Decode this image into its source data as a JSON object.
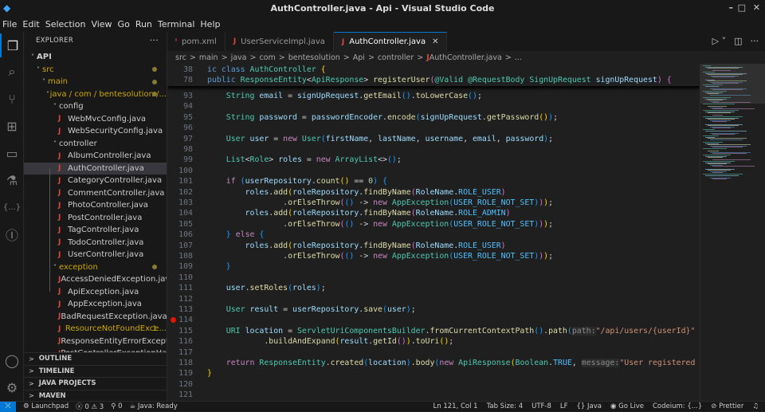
{
  "window": {
    "title": "AuthController.java - Api - Visual Studio Code",
    "controls": [
      "–",
      "□",
      "✕"
    ]
  },
  "menu": [
    "File",
    "Edit",
    "Selection",
    "View",
    "Go",
    "Run",
    "Terminal",
    "Help"
  ],
  "sidebar": {
    "title": "EXPLORER",
    "more": "···",
    "tree": [
      {
        "label": "API",
        "depth": 0,
        "folder": true,
        "bold": true
      },
      {
        "label": "src",
        "depth": 1,
        "folder": true,
        "modified": true,
        "dot": true
      },
      {
        "label": "main",
        "depth": 2,
        "folder": true,
        "modified": true,
        "dot": true
      },
      {
        "label": "java / com / bentesolution /...",
        "depth": 3,
        "folder": true,
        "modified": true,
        "dot": true
      },
      {
        "label": "config",
        "depth": 4,
        "folder": true
      },
      {
        "label": "WebMvcConfig.java",
        "depth": 5
      },
      {
        "label": "WebSecurityConfig.java",
        "depth": 5
      },
      {
        "label": "controller",
        "depth": 4,
        "folder": true
      },
      {
        "label": "AlbumController.java",
        "depth": 5
      },
      {
        "label": "AuthController.java",
        "depth": 5,
        "selected": true
      },
      {
        "label": "CategoryController.java",
        "depth": 5
      },
      {
        "label": "CommentController.java",
        "depth": 5
      },
      {
        "label": "PhotoController.java",
        "depth": 5
      },
      {
        "label": "PostController.java",
        "depth": 5
      },
      {
        "label": "TagController.java",
        "depth": 5
      },
      {
        "label": "TodoController.java",
        "depth": 5
      },
      {
        "label": "UserController.java",
        "depth": 5
      },
      {
        "label": "exception",
        "depth": 4,
        "folder": true,
        "modified": true,
        "dot": true
      },
      {
        "label": "AccessDeniedException.java",
        "depth": 5
      },
      {
        "label": "ApiException.java",
        "depth": 5
      },
      {
        "label": "AppException.java",
        "depth": 5
      },
      {
        "label": "BadRequestException.java",
        "depth": 5
      },
      {
        "label": "ResourceNotFoundExce...",
        "depth": 5,
        "modified": true,
        "count": "1"
      },
      {
        "label": "ResponseEntityErrorExceptio...",
        "depth": 5
      },
      {
        "label": "PostControllerExceptionHan...",
        "depth": 5
      }
    ],
    "panes": [
      "OUTLINE",
      "TIMELINE",
      "JAVA PROJECTS",
      "MAVEN"
    ]
  },
  "tabs": [
    {
      "label": "pom.xml",
      "icon": "xml-icon",
      "active": false
    },
    {
      "label": "UserServiceImpl.java",
      "icon": "java-icon",
      "active": false
    },
    {
      "label": "AuthController.java",
      "icon": "java-icon",
      "active": true
    }
  ],
  "breadcrumb": [
    "src",
    "main",
    "java",
    "com",
    "bentesolution",
    "Api",
    "controller",
    "AuthController.java",
    "..."
  ],
  "editor": {
    "sticky": [
      {
        "num": "38",
        "tokens": [
          [
            "k",
            "ic class "
          ],
          [
            "t",
            "AuthController"
          ],
          [
            "p",
            " "
          ],
          [
            "b1",
            "{"
          ]
        ]
      },
      {
        "num": "78",
        "tokens": [
          [
            "k",
            "public "
          ],
          [
            "t",
            "ResponseEntity"
          ],
          [
            "p",
            "<"
          ],
          [
            "t",
            "ApiResponse"
          ],
          [
            "p",
            "> "
          ],
          [
            "m",
            "registerUser"
          ],
          [
            "b2",
            "("
          ],
          [
            "t",
            "@Valid "
          ],
          [
            "t",
            "@RequestBody "
          ],
          [
            "t",
            "SignUpRequest "
          ],
          [
            "v",
            "signUpRequest"
          ],
          [
            "b2",
            ")"
          ],
          [
            "p",
            " "
          ],
          [
            "b2",
            "{"
          ]
        ]
      }
    ],
    "lines": [
      {
        "num": "93",
        "tokens": [
          [
            "t",
            "    String "
          ],
          [
            "v",
            "email"
          ],
          [
            "p",
            " = "
          ],
          [
            "v",
            "signUpRequest"
          ],
          [
            "p",
            "."
          ],
          [
            "m",
            "getEmail"
          ],
          [
            "b3",
            "()"
          ],
          [
            "p",
            "."
          ],
          [
            "m",
            "toLowerCase"
          ],
          [
            "b3",
            "()"
          ],
          [
            "p",
            ";"
          ]
        ]
      },
      {
        "num": "94",
        "tokens": []
      },
      {
        "num": "95",
        "tokens": [
          [
            "t",
            "    String "
          ],
          [
            "v",
            "password"
          ],
          [
            "p",
            " = "
          ],
          [
            "v",
            "passwordEncoder"
          ],
          [
            "p",
            "."
          ],
          [
            "m",
            "encode"
          ],
          [
            "b3",
            "("
          ],
          [
            "v",
            "signUpRequest"
          ],
          [
            "p",
            "."
          ],
          [
            "m",
            "getPassword"
          ],
          [
            "b1",
            "()"
          ],
          [
            "b3",
            ")"
          ],
          [
            "p",
            ";"
          ]
        ]
      },
      {
        "num": "96",
        "tokens": []
      },
      {
        "num": "97",
        "tokens": [
          [
            "t",
            "    User "
          ],
          [
            "v",
            "user"
          ],
          [
            "p",
            " = "
          ],
          [
            "c",
            "new "
          ],
          [
            "t",
            "User"
          ],
          [
            "b3",
            "("
          ],
          [
            "v",
            "firstName"
          ],
          [
            "p",
            ", "
          ],
          [
            "v",
            "lastName"
          ],
          [
            "p",
            ", "
          ],
          [
            "v",
            "username"
          ],
          [
            "p",
            ", "
          ],
          [
            "v",
            "email"
          ],
          [
            "p",
            ", "
          ],
          [
            "v",
            "password"
          ],
          [
            "b3",
            ")"
          ],
          [
            "p",
            ";"
          ]
        ]
      },
      {
        "num": "98",
        "tokens": []
      },
      {
        "num": "99",
        "tokens": [
          [
            "t",
            "    List"
          ],
          [
            "p",
            "<"
          ],
          [
            "t",
            "Role"
          ],
          [
            "p",
            "> "
          ],
          [
            "v",
            "roles"
          ],
          [
            "p",
            " = "
          ],
          [
            "c",
            "new "
          ],
          [
            "t",
            "ArrayList"
          ],
          [
            "p",
            "<>"
          ],
          [
            "b3",
            "()"
          ],
          [
            "p",
            ";"
          ]
        ]
      },
      {
        "num": "100",
        "tokens": []
      },
      {
        "num": "101",
        "tokens": [
          [
            "c",
            "    if "
          ],
          [
            "b3",
            "("
          ],
          [
            "v",
            "userRepository"
          ],
          [
            "p",
            "."
          ],
          [
            "m",
            "count"
          ],
          [
            "b1",
            "()"
          ],
          [
            "p",
            " == "
          ],
          [
            "n",
            "0"
          ],
          [
            "b3",
            ")"
          ],
          [
            "p",
            " "
          ],
          [
            "b3",
            "{"
          ]
        ]
      },
      {
        "num": "102",
        "tokens": [
          [
            "v",
            "        roles"
          ],
          [
            "p",
            "."
          ],
          [
            "m",
            "add"
          ],
          [
            "b1",
            "("
          ],
          [
            "v",
            "roleRepository"
          ],
          [
            "p",
            "."
          ],
          [
            "m",
            "findByName"
          ],
          [
            "b2",
            "("
          ],
          [
            "v",
            "RoleName"
          ],
          [
            "p",
            "."
          ],
          [
            "o",
            "ROLE_USER"
          ],
          [
            "b2",
            ")"
          ]
        ]
      },
      {
        "num": "103",
        "tokens": [
          [
            "p",
            "                ."
          ],
          [
            "m",
            "orElseThrow"
          ],
          [
            "b2",
            "("
          ],
          [
            "b3",
            "()"
          ],
          [
            "p",
            " -> "
          ],
          [
            "c",
            "new "
          ],
          [
            "t",
            "AppException"
          ],
          [
            "b3",
            "("
          ],
          [
            "o",
            "USER_ROLE_NOT_SET"
          ],
          [
            "b3",
            ")"
          ],
          [
            "b2",
            ")"
          ],
          [
            "b1",
            ")"
          ],
          [
            "p",
            ";"
          ]
        ]
      },
      {
        "num": "104",
        "tokens": [
          [
            "v",
            "        roles"
          ],
          [
            "p",
            "."
          ],
          [
            "m",
            "add"
          ],
          [
            "b1",
            "("
          ],
          [
            "v",
            "roleRepository"
          ],
          [
            "p",
            "."
          ],
          [
            "m",
            "findByName"
          ],
          [
            "b2",
            "("
          ],
          [
            "v",
            "RoleName"
          ],
          [
            "p",
            "."
          ],
          [
            "o",
            "ROLE_ADMIN"
          ],
          [
            "b2",
            ")"
          ]
        ]
      },
      {
        "num": "105",
        "tokens": [
          [
            "p",
            "                ."
          ],
          [
            "m",
            "orElseThrow"
          ],
          [
            "b2",
            "("
          ],
          [
            "b3",
            "()"
          ],
          [
            "p",
            " -> "
          ],
          [
            "c",
            "new "
          ],
          [
            "t",
            "AppException"
          ],
          [
            "b3",
            "("
          ],
          [
            "o",
            "USER_ROLE_NOT_SET"
          ],
          [
            "b3",
            ")"
          ],
          [
            "b2",
            ")"
          ],
          [
            "b1",
            ")"
          ],
          [
            "p",
            ";"
          ]
        ]
      },
      {
        "num": "106",
        "tokens": [
          [
            "b3",
            "    }"
          ],
          [
            "p",
            " "
          ],
          [
            "c",
            "else "
          ],
          [
            "b3",
            "{"
          ]
        ]
      },
      {
        "num": "107",
        "tokens": [
          [
            "v",
            "        roles"
          ],
          [
            "p",
            "."
          ],
          [
            "m",
            "add"
          ],
          [
            "b1",
            "("
          ],
          [
            "v",
            "roleRepository"
          ],
          [
            "p",
            "."
          ],
          [
            "m",
            "findByName"
          ],
          [
            "b2",
            "("
          ],
          [
            "v",
            "RoleName"
          ],
          [
            "p",
            "."
          ],
          [
            "o",
            "ROLE_USER"
          ],
          [
            "b2",
            ")"
          ]
        ]
      },
      {
        "num": "108",
        "tokens": [
          [
            "p",
            "                ."
          ],
          [
            "m",
            "orElseThrow"
          ],
          [
            "b2",
            "("
          ],
          [
            "b3",
            "()"
          ],
          [
            "p",
            " -> "
          ],
          [
            "c",
            "new "
          ],
          [
            "t",
            "AppException"
          ],
          [
            "b3",
            "("
          ],
          [
            "o",
            "USER_ROLE_NOT_SET"
          ],
          [
            "b3",
            ")"
          ],
          [
            "b2",
            ")"
          ],
          [
            "b1",
            ")"
          ],
          [
            "p",
            ";"
          ]
        ]
      },
      {
        "num": "109",
        "tokens": [
          [
            "b3",
            "    }"
          ]
        ]
      },
      {
        "num": "110",
        "tokens": []
      },
      {
        "num": "111",
        "tokens": [
          [
            "v",
            "    user"
          ],
          [
            "p",
            "."
          ],
          [
            "m",
            "setRoles"
          ],
          [
            "b3",
            "("
          ],
          [
            "v",
            "roles"
          ],
          [
            "b3",
            ")"
          ],
          [
            "p",
            ";"
          ]
        ]
      },
      {
        "num": "112",
        "tokens": []
      },
      {
        "num": "113",
        "tokens": [
          [
            "t",
            "    User "
          ],
          [
            "v",
            "result"
          ],
          [
            "p",
            " = "
          ],
          [
            "v",
            "userRepository"
          ],
          [
            "p",
            "."
          ],
          [
            "m",
            "save"
          ],
          [
            "b3",
            "("
          ],
          [
            "v",
            "user"
          ],
          [
            "b3",
            ")"
          ],
          [
            "p",
            ";"
          ]
        ]
      },
      {
        "num": "114",
        "tokens": [],
        "breakpoint": true
      },
      {
        "num": "115",
        "tokens": [
          [
            "t",
            "    URI "
          ],
          [
            "v",
            "location"
          ],
          [
            "p",
            " = "
          ],
          [
            "t",
            "ServletUriComponentsBuilder"
          ],
          [
            "p",
            "."
          ],
          [
            "m",
            "fromCurrentContextPath"
          ],
          [
            "b3",
            "()"
          ],
          [
            "p",
            "."
          ],
          [
            "m",
            "path"
          ],
          [
            "b3",
            "("
          ],
          [
            "h",
            "path:"
          ],
          [
            "s",
            "\"/api/users/{userId}\""
          ]
        ]
      },
      {
        "num": "116",
        "tokens": [
          [
            "p",
            "            ."
          ],
          [
            "m",
            "buildAndExpand"
          ],
          [
            "b1",
            "("
          ],
          [
            "v",
            "result"
          ],
          [
            "p",
            "."
          ],
          [
            "m",
            "getId"
          ],
          [
            "b2",
            "()"
          ],
          [
            "b1",
            ")"
          ],
          [
            "p",
            "."
          ],
          [
            "m",
            "toUri"
          ],
          [
            "b1",
            "()"
          ],
          [
            "p",
            ";"
          ]
        ]
      },
      {
        "num": "117",
        "tokens": []
      },
      {
        "num": "118",
        "tokens": [
          [
            "c",
            "    return "
          ],
          [
            "t",
            "ResponseEntity"
          ],
          [
            "p",
            "."
          ],
          [
            "m",
            "created"
          ],
          [
            "b3",
            "("
          ],
          [
            "v",
            "location"
          ],
          [
            "b3",
            ")"
          ],
          [
            "p",
            "."
          ],
          [
            "m",
            "body"
          ],
          [
            "b3",
            "("
          ],
          [
            "c",
            "new "
          ],
          [
            "t",
            "ApiResponse"
          ],
          [
            "b1",
            "("
          ],
          [
            "t",
            "Boolean"
          ],
          [
            "p",
            "."
          ],
          [
            "o",
            "TRUE"
          ],
          [
            "p",
            ", "
          ],
          [
            "h",
            "message:"
          ],
          [
            "s",
            "\"User registered"
          ]
        ]
      },
      {
        "num": "119",
        "tokens": [
          [
            "b1",
            "}"
          ]
        ]
      },
      {
        "num": "120",
        "tokens": []
      },
      {
        "num": "121",
        "tokens": []
      }
    ]
  },
  "status": {
    "launchpad": "Launchpad",
    "errors": "0",
    "warnings": "3",
    "ports": "0",
    "java": "Java: Ready",
    "position": "Ln 121, Col 1",
    "tab_size": "Tab Size: 4",
    "encoding": "UTF-8",
    "eol": "LF",
    "language": "Java",
    "golive": "Go Live",
    "codeium": "Codeium: {...}",
    "prettier": "Prettier"
  },
  "colors": {
    "accent": "#0078d4",
    "java_icon": "#e0463a",
    "modified": "#cca700",
    "breakpoint": "#e51400"
  }
}
